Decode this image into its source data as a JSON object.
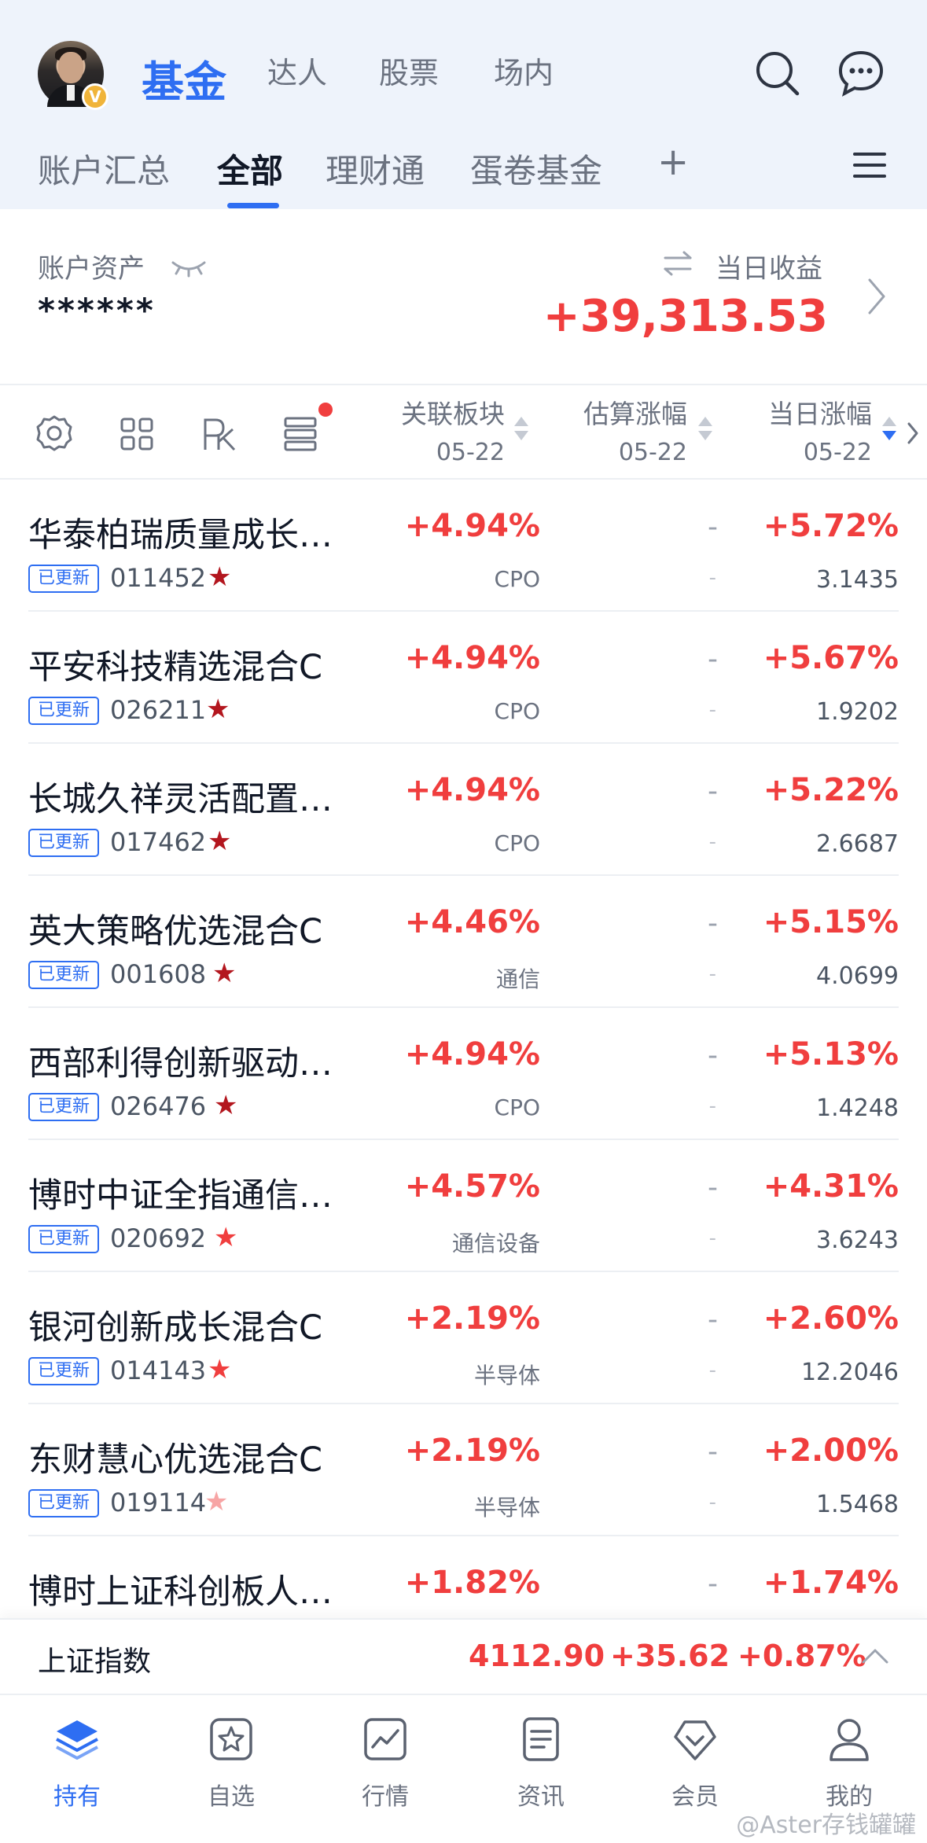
{
  "header": {
    "tabs": [
      {
        "label": "基金",
        "active": true
      },
      {
        "label": "达人",
        "active": false
      },
      {
        "label": "股票",
        "active": false
      },
      {
        "label": "场内",
        "active": false
      }
    ],
    "avatar_badge": "V",
    "subtabs": [
      {
        "label": "账户汇总",
        "active": false
      },
      {
        "label": "全部",
        "active": true
      },
      {
        "label": "理财通",
        "active": false
      },
      {
        "label": "蛋卷基金",
        "active": false
      }
    ],
    "add_label": "+"
  },
  "account": {
    "assets_label": "账户资产",
    "assets_value": "******",
    "daily_label": "当日收益",
    "daily_value": "+39,313.53"
  },
  "table_header": {
    "col1": {
      "title": "关联板块",
      "date": "05-22"
    },
    "col2": {
      "title": "估算涨幅",
      "date": "05-22"
    },
    "col3": {
      "title": "当日涨幅",
      "date": "05-22"
    }
  },
  "funds": [
    {
      "name": "华泰柏瑞质量成长…",
      "tag": "已更新",
      "code": "011452",
      "star": "dark",
      "sector_change": "+4.94%",
      "sector": "CPO",
      "est": "-",
      "est_sub": "-",
      "day_change": "+5.72%",
      "nav": "3.1435"
    },
    {
      "name": "平安科技精选混合C",
      "tag": "已更新",
      "code": "026211",
      "star": "dark",
      "sector_change": "+4.94%",
      "sector": "CPO",
      "est": "-",
      "est_sub": "-",
      "day_change": "+5.67%",
      "nav": "1.9202"
    },
    {
      "name": "长城久祥灵活配置…",
      "tag": "已更新",
      "code": "017462",
      "star": "dark",
      "sector_change": "+4.94%",
      "sector": "CPO",
      "est": "-",
      "est_sub": "-",
      "day_change": "+5.22%",
      "nav": "2.6687"
    },
    {
      "name": "英大策略优选混合C",
      "tag": "已更新",
      "code": "001608",
      "star": "dark",
      "sector_change": "+4.46%",
      "sector": "通信",
      "est": "-",
      "est_sub": "-",
      "day_change": "+5.15%",
      "nav": "4.0699"
    },
    {
      "name": "西部利得创新驱动…",
      "tag": "已更新",
      "code": "026476",
      "star": "dark",
      "sector_change": "+4.94%",
      "sector": "CPO",
      "est": "-",
      "est_sub": "-",
      "day_change": "+5.13%",
      "nav": "1.4248"
    },
    {
      "name": "博时中证全指通信…",
      "tag": "已更新",
      "code": "020692",
      "star": "red",
      "sector_change": "+4.57%",
      "sector": "通信设备",
      "est": "-",
      "est_sub": "-",
      "day_change": "+4.31%",
      "nav": "3.6243"
    },
    {
      "name": "银河创新成长混合C",
      "tag": "已更新",
      "code": "014143",
      "star": "red",
      "sector_change": "+2.19%",
      "sector": "半导体",
      "est": "-",
      "est_sub": "-",
      "day_change": "+2.60%",
      "nav": "12.2046"
    },
    {
      "name": "东财慧心优选混合C",
      "tag": "已更新",
      "code": "019114",
      "star": "light",
      "sector_change": "+2.19%",
      "sector": "半导体",
      "est": "-",
      "est_sub": "-",
      "day_change": "+2.00%",
      "nav": "1.5468"
    },
    {
      "name": "博时上证科创板人…",
      "tag": "",
      "code": "",
      "star": "",
      "sector_change": "+1.82%",
      "sector": "",
      "est": "-",
      "est_sub": "",
      "day_change": "+1.74%",
      "nav": ""
    }
  ],
  "index_bar": {
    "name": "上证指数",
    "value": "4112.90",
    "change": "+35.62",
    "pct": "+0.87%"
  },
  "nav": [
    {
      "label": "持有",
      "icon": "layers-icon",
      "active": true
    },
    {
      "label": "自选",
      "icon": "star-square-icon",
      "active": false
    },
    {
      "label": "行情",
      "icon": "chart-icon",
      "active": false
    },
    {
      "label": "资讯",
      "icon": "document-icon",
      "active": false
    },
    {
      "label": "会员",
      "icon": "diamond-icon",
      "active": false
    },
    {
      "label": "我的",
      "icon": "user-icon",
      "active": false
    }
  ],
  "watermark": "@Aster存钱罐罐",
  "colors": {
    "accent": "#2e6ef2",
    "up": "#f03e3e",
    "star_dark": "#b3161e",
    "star_red": "#f03e3e",
    "star_light": "#f7a5a5"
  }
}
